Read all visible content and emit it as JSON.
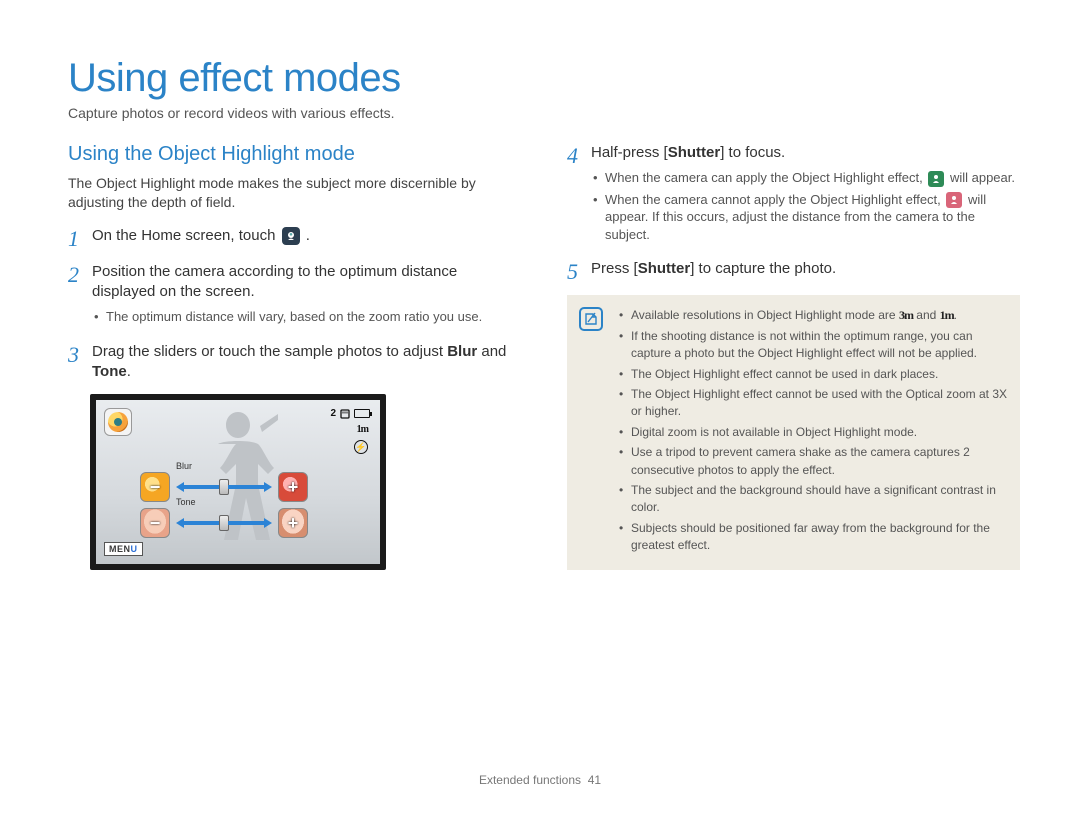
{
  "header": {
    "title": "Using effect modes",
    "intro": "Capture photos or record videos with various effects."
  },
  "left": {
    "subheading": "Using the Object Highlight mode",
    "desc": "The Object Highlight mode makes the subject more discernible by adjusting the depth of field.",
    "steps": {
      "s1_pre": "On the Home screen, touch ",
      "s1_post": ".",
      "s2": "Position the camera according to the optimum distance displayed on the screen.",
      "s2_sub1": "The optimum distance will vary, based on the zoom ratio you use.",
      "s3_pre": "Drag the sliders or touch the sample photos to adjust ",
      "s3_b1": "Blur",
      "s3_mid": " and ",
      "s3_b2": "Tone",
      "s3_post": "."
    },
    "lcd": {
      "shots_left": "2",
      "res": "1m",
      "slider1_label": "Blur",
      "slider2_label": "Tone",
      "menu_pre": "MEN",
      "menu_u": "U"
    }
  },
  "right": {
    "steps": {
      "s4_pre": "Half-press [",
      "s4_b": "Shutter",
      "s4_post": "] to focus.",
      "s4_sub1_pre": "When the camera can apply the Object Highlight effect, ",
      "s4_sub1_post": " will appear.",
      "s4_sub2_pre": "When the camera cannot apply the Object Highlight effect, ",
      "s4_sub2_post": " will appear. If this occurs, adjust the distance from the camera to the subject.",
      "s5_pre": "Press [",
      "s5_b": "Shutter",
      "s5_post": "] to capture the photo."
    },
    "notes": {
      "n1_pre": "Available resolutions in Object Highlight mode are ",
      "n1_r1": "3m",
      "n1_mid": " and ",
      "n1_r2": "1m",
      "n1_post": ".",
      "n2": "If the shooting distance is not within the optimum range, you can capture a photo but the Object Highlight effect will not be applied.",
      "n3": "The Object Highlight effect cannot be used in dark places.",
      "n4": "The Object Highlight effect cannot be used with the Optical zoom at 3X or higher.",
      "n5": "Digital zoom is not available in Object Highlight mode.",
      "n6": "Use a tripod to prevent camera shake as the camera captures 2 consecutive photos to apply the effect.",
      "n7": "The subject and the background should have a significant contrast in color.",
      "n8": "Subjects should be positioned far away from the background for the greatest effect."
    }
  },
  "footer": {
    "section": "Extended functions",
    "page": "41"
  }
}
